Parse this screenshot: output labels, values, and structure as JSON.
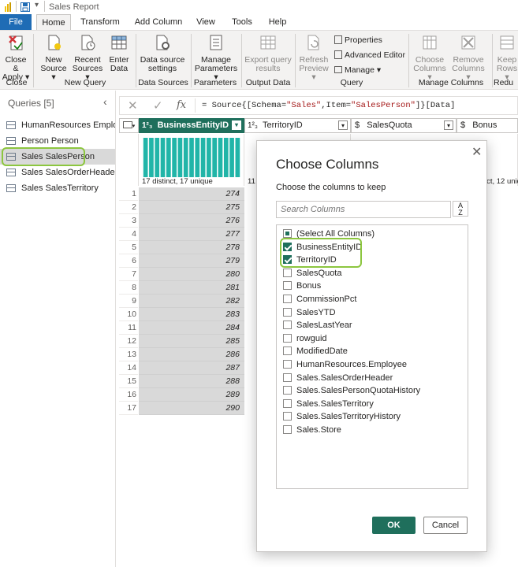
{
  "window": {
    "title": "Sales Report"
  },
  "tabs": [
    "File",
    "Home",
    "Transform",
    "Add Column",
    "View",
    "Tools",
    "Help"
  ],
  "ribbon": {
    "buttons": [
      {
        "l1": "Close &",
        "l2": "Apply ▾",
        "dis": false,
        "icon": "close-apply-icon"
      },
      {
        "l1": "New",
        "l2": "Source ▾",
        "dis": false,
        "icon": "new-source-icon"
      },
      {
        "l1": "Recent",
        "l2": "Sources ▾",
        "dis": false,
        "icon": "recent-sources-icon"
      },
      {
        "l1": "Enter",
        "l2": "Data",
        "dis": false,
        "icon": "enter-data-icon"
      },
      {
        "l1": "Data source",
        "l2": "settings",
        "dis": false,
        "icon": "data-source-settings-icon"
      },
      {
        "l1": "Manage",
        "l2": "Parameters ▾",
        "dis": false,
        "icon": "manage-parameters-icon"
      },
      {
        "l1": "Export query",
        "l2": "results",
        "dis": true,
        "icon": "export-icon"
      },
      {
        "l1": "Refresh",
        "l2": "Preview ▾",
        "dis": true,
        "icon": "refresh-icon"
      },
      {
        "l1": "Choose",
        "l2": "Columns ▾",
        "dis": true,
        "icon": "choose-columns-icon"
      },
      {
        "l1": "Remove",
        "l2": "Columns ▾",
        "dis": true,
        "icon": "remove-columns-icon"
      },
      {
        "l1": "Keep",
        "l2": "Rows ▾",
        "dis": true,
        "icon": "keep-rows-icon"
      }
    ],
    "small": [
      "Properties",
      "Advanced Editor",
      "Manage ▾"
    ],
    "groups": [
      "Close",
      "New Query",
      "Data Sources",
      "Parameters",
      "Output Data",
      "Query",
      "Manage Columns",
      "Redu"
    ]
  },
  "queries": {
    "header": "Queries [5]",
    "items": [
      "HumanResources Emplo...",
      "Person Person",
      "Sales SalesPerson",
      "Sales SalesOrderHeader",
      "Sales SalesTerritory"
    ],
    "selected": 2
  },
  "formula": {
    "fx": "fx",
    "p1": "= Source{[Schema=",
    "s1": "\"Sales\"",
    "p2": ",Item=",
    "s2": "\"SalesPerson\"",
    "p3": "]}[Data]"
  },
  "grid": {
    "columns": [
      {
        "type": "1²₃",
        "name": "BusinessEntityID"
      },
      {
        "type": "1²₃",
        "name": "TerritoryID"
      },
      {
        "type": "$",
        "name": "SalesQuota"
      },
      {
        "type": "$",
        "name": "Bonus"
      }
    ],
    "profile1": "17 distinct, 17 unique",
    "profile2": "11",
    "profile_partial": "ict, 12 uniqu",
    "rows": [
      274,
      275,
      276,
      277,
      278,
      279,
      280,
      281,
      282,
      283,
      284,
      285,
      286,
      287,
      288,
      289,
      290
    ]
  },
  "dialog": {
    "title": "Choose Columns",
    "subtitle": "Choose the columns to keep",
    "search_placeholder": "Search Columns",
    "sort_label": "A\nZ",
    "items": [
      {
        "label": "(Select All Columns)",
        "state": "partial"
      },
      {
        "label": "BusinessEntityID",
        "state": "on"
      },
      {
        "label": "TerritoryID",
        "state": "on"
      },
      {
        "label": "SalesQuota",
        "state": "off"
      },
      {
        "label": "Bonus",
        "state": "off"
      },
      {
        "label": "CommissionPct",
        "state": "off"
      },
      {
        "label": "SalesYTD",
        "state": "off"
      },
      {
        "label": "SalesLastYear",
        "state": "off"
      },
      {
        "label": "rowguid",
        "state": "off"
      },
      {
        "label": "ModifiedDate",
        "state": "off"
      },
      {
        "label": "HumanResources.Employee",
        "state": "off"
      },
      {
        "label": "Sales.SalesOrderHeader",
        "state": "off"
      },
      {
        "label": "Sales.SalesPersonQuotaHistory",
        "state": "off"
      },
      {
        "label": "Sales.SalesTerritory",
        "state": "off"
      },
      {
        "label": "Sales.SalesTerritoryHistory",
        "state": "off"
      },
      {
        "label": "Sales.Store",
        "state": "off"
      }
    ],
    "ok": "OK",
    "cancel": "Cancel"
  },
  "colors": {
    "accent": "#1f6f5c",
    "file_tab": "#1f6cb5",
    "highlight": "#8cc63f",
    "profile_bar": "#21b5a8"
  }
}
